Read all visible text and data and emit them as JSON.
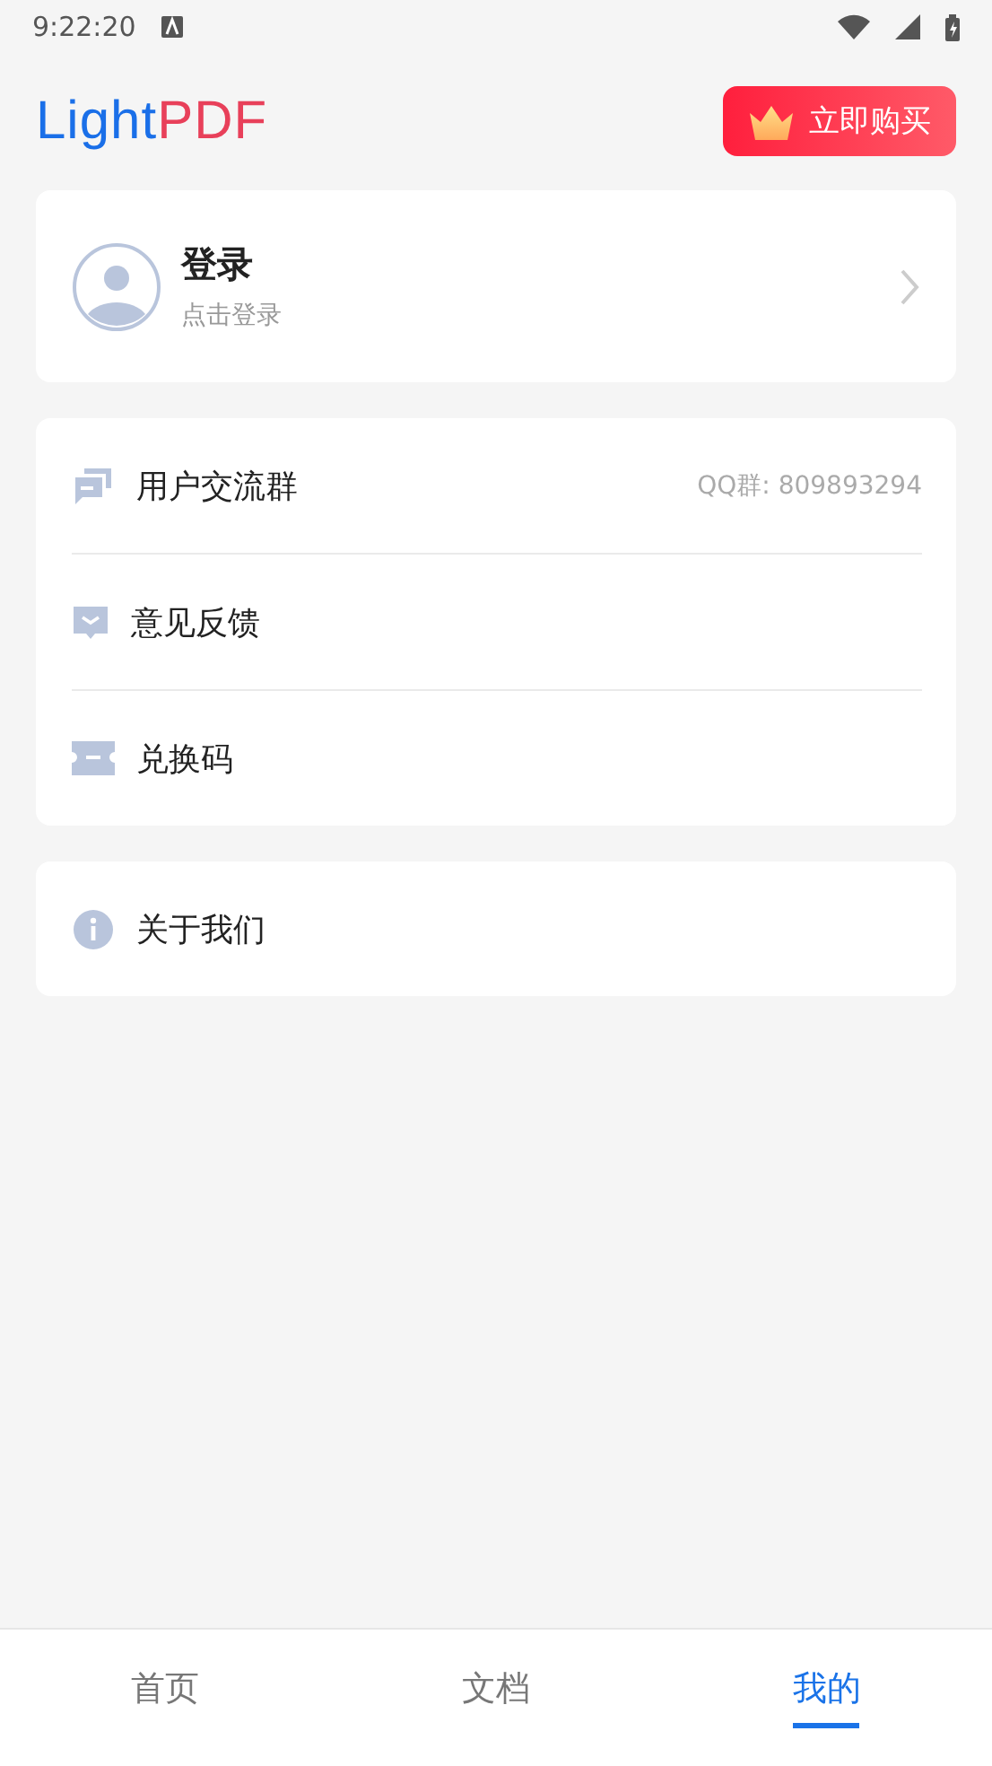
{
  "status_bar": {
    "time": "9:22:20"
  },
  "header": {
    "logo": [
      "Light",
      "PDF"
    ],
    "buy_button": "立即购买"
  },
  "login_card": {
    "title": "登录",
    "subtitle": "点击登录"
  },
  "menu_groups": [
    {
      "items": [
        {
          "kind": "group",
          "label": "用户交流群",
          "detail": "QQ群: 809893294"
        },
        {
          "kind": "feedback",
          "label": "意见反馈"
        },
        {
          "kind": "code",
          "label": "兑换码"
        }
      ]
    },
    {
      "items": [
        {
          "kind": "info",
          "label": "关于我们"
        }
      ]
    }
  ],
  "bottom_nav": [
    {
      "label": "首页",
      "selected": false
    },
    {
      "label": "文档",
      "selected": false
    },
    {
      "label": "我的",
      "selected": true
    }
  ]
}
